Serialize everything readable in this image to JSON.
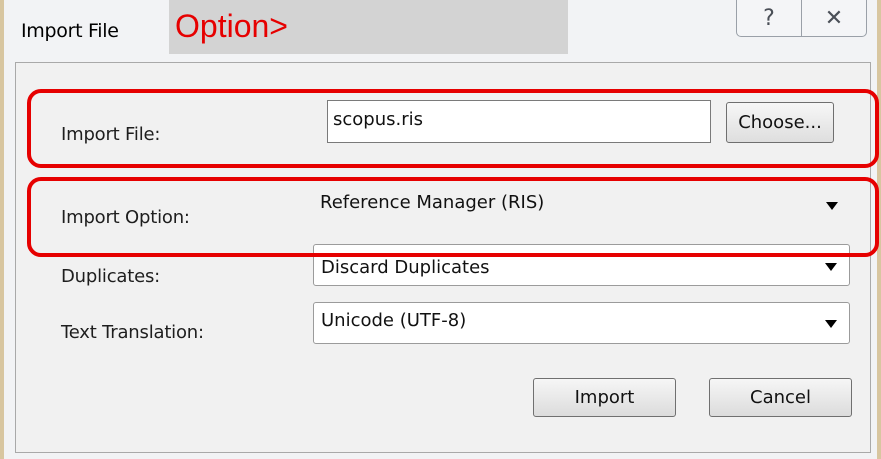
{
  "window": {
    "title": "Import File",
    "help_glyph": "?",
    "close_glyph": "✕"
  },
  "callout": {
    "text": "Option>"
  },
  "form": {
    "import_file_label": "Import File:",
    "import_file_value": "scopus.ris",
    "choose_label": "Choose...",
    "import_option_label": "Import Option:",
    "import_option_value": "Reference Manager (RIS)",
    "duplicates_label": "Duplicates:",
    "duplicates_value": "Discard Duplicates",
    "translation_label": "Text Translation:",
    "translation_value": "Unicode (UTF-8)"
  },
  "buttons": {
    "import": "Import",
    "cancel": "Cancel"
  },
  "colors": {
    "highlight": "#e60000",
    "callout_bg": "#d3d3d3",
    "frame": "#d8c6a0"
  },
  "icons": [
    "help-icon",
    "close-icon",
    "dropdown-arrow-icon"
  ]
}
